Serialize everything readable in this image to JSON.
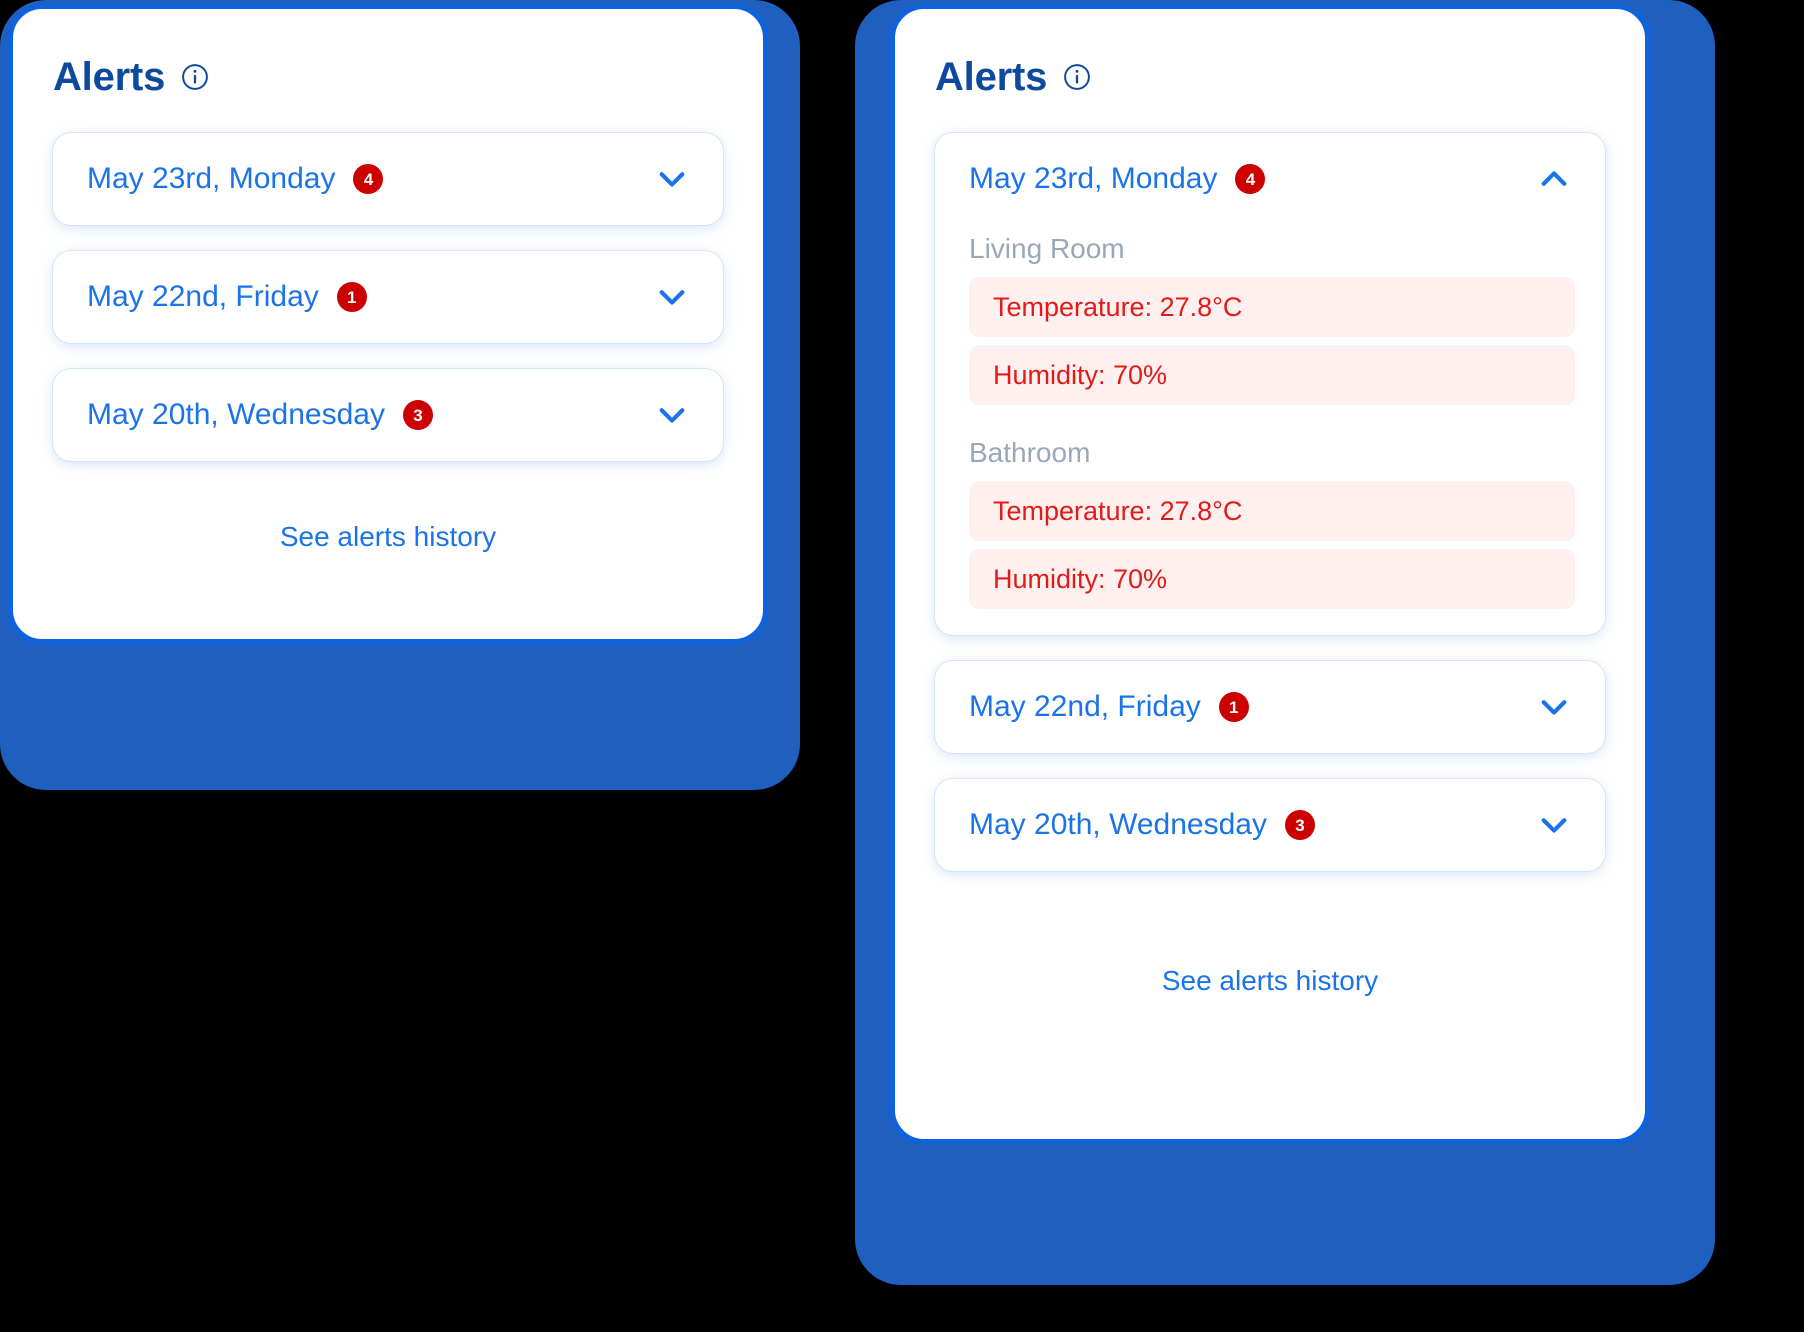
{
  "colors": {
    "page_background": "#000000",
    "backdrop_blue": "#1f5fc0",
    "panel_border_blue": "#0f62de",
    "title_navy": "#0d4a9e",
    "link_blue": "#1a73e8",
    "badge_red": "#cc0000",
    "alert_text_red": "#e01b19",
    "alert_pill_background": "#fdf0ef",
    "room_label_gray": "#9aa7b8",
    "card_white": "#ffffff"
  },
  "panels": {
    "left": {
      "title": "Alerts",
      "info_icon": "info-circle-icon",
      "groups": [
        {
          "date": "May 23rd, Monday",
          "badge": "4",
          "expanded": false,
          "chevron": "chevron-down-icon"
        },
        {
          "date": "May 22nd, Friday",
          "badge": "1",
          "expanded": false,
          "chevron": "chevron-down-icon"
        },
        {
          "date": "May 20th, Wednesday",
          "badge": "3",
          "expanded": false,
          "chevron": "chevron-down-icon"
        }
      ],
      "history_link": "See alerts history"
    },
    "right": {
      "title": "Alerts",
      "info_icon": "info-circle-icon",
      "groups": [
        {
          "date": "May 23rd, Monday",
          "badge": "4",
          "expanded": true,
          "chevron": "chevron-up-icon",
          "rooms": [
            {
              "name": "Living Room",
              "alerts": [
                "Temperature: 27.8°C",
                "Humidity: 70%"
              ]
            },
            {
              "name": "Bathroom",
              "alerts": [
                "Temperature: 27.8°C",
                "Humidity: 70%"
              ]
            }
          ]
        },
        {
          "date": "May 22nd, Friday",
          "badge": "1",
          "expanded": false,
          "chevron": "chevron-down-icon"
        },
        {
          "date": "May 20th, Wednesday",
          "badge": "3",
          "expanded": false,
          "chevron": "chevron-down-icon"
        }
      ],
      "history_link": "See alerts history"
    }
  }
}
